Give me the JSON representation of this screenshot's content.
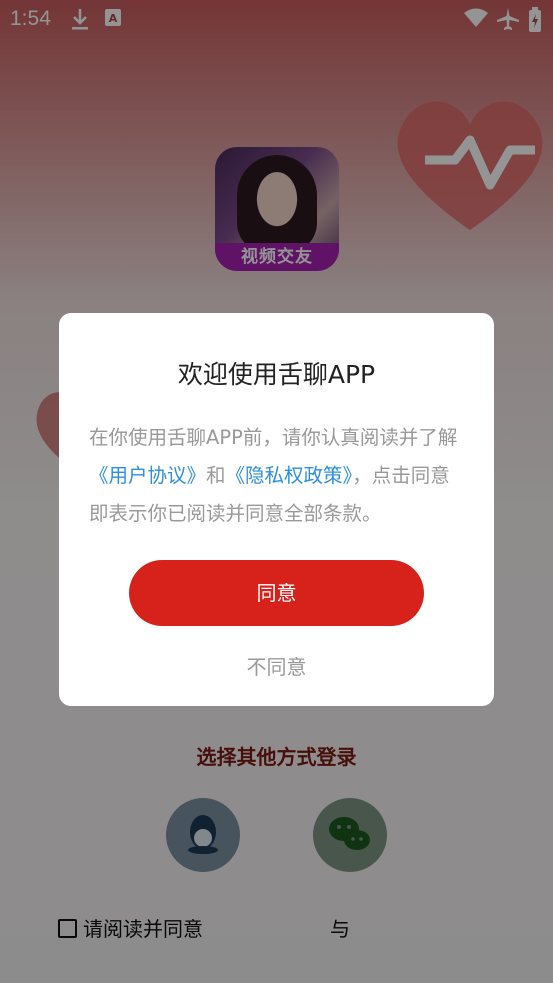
{
  "status_bar": {
    "time": "1:54",
    "icons": [
      "download-icon",
      "a-notification-icon",
      "wifi-icon",
      "airplane-mode-icon",
      "battery-charging-icon"
    ]
  },
  "app": {
    "logo_label": "视频交友"
  },
  "dialog": {
    "title": "欢迎使用舌聊APP",
    "body_prefix": "在你使用舌聊APP前，请你认真阅读并了解",
    "user_agreement": "《用户协议》",
    "and": "和",
    "privacy_policy": "《隐私权政策》",
    "body_suffix": "，点击同意即表示你已阅读并同意全部条款。",
    "agree_label": "同意",
    "disagree_label": "不同意"
  },
  "login": {
    "other_methods": "选择其他方式登录",
    "qq_icon": "qq-icon",
    "wechat_icon": "wechat-icon",
    "agree_text": "请阅读并同意",
    "and_text": "与"
  },
  "colors": {
    "accent_red": "#d7221c",
    "link_blue": "#2d8fe0",
    "logo_purple": "#a51fb0"
  }
}
